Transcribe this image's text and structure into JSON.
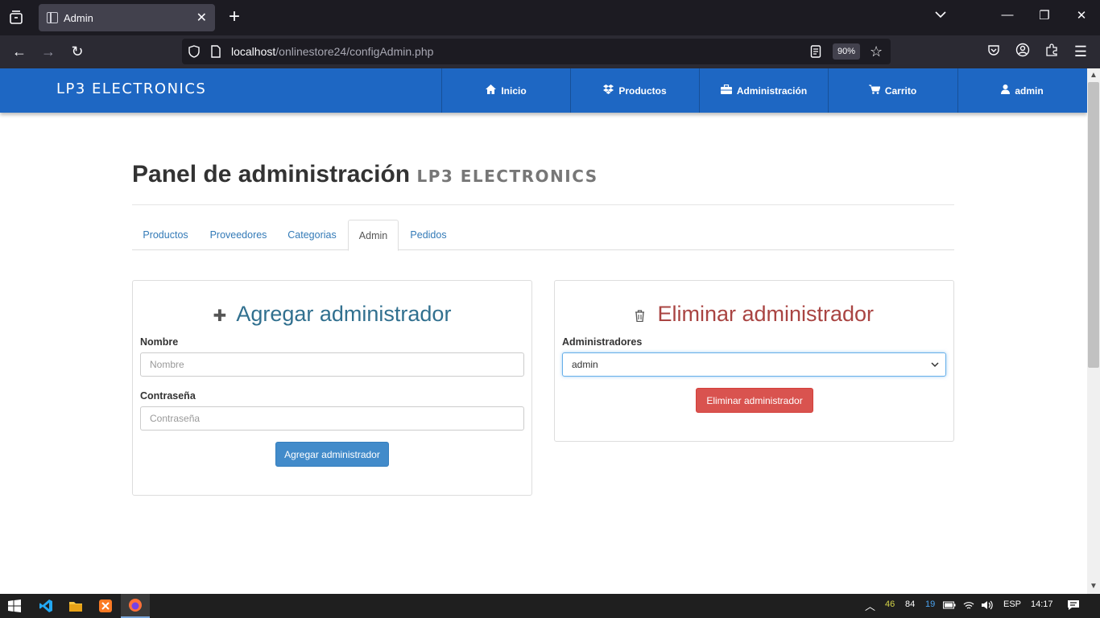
{
  "browser": {
    "tab_title": "Admin",
    "url_host": "localhost",
    "url_path": "/onlinestore24/configAdmin.php",
    "zoom": "90%"
  },
  "header": {
    "brand": "LP3 ELECTRONICS",
    "nav": [
      {
        "label": "Inicio",
        "icon": "home-icon"
      },
      {
        "label": "Productos",
        "icon": "dropbox-icon"
      },
      {
        "label": "Administración",
        "icon": "briefcase-icon"
      },
      {
        "label": "Carrito",
        "icon": "cart-icon"
      },
      {
        "label": "admin",
        "icon": "user-icon"
      }
    ]
  },
  "page": {
    "title": "Panel de administración",
    "title_sub": "LP3 ELECTRONICS",
    "tabs": [
      "Productos",
      "Proveedores",
      "Categorias",
      "Admin",
      "Pedidos"
    ],
    "active_tab": "Admin"
  },
  "add_panel": {
    "heading": "Agregar administrador",
    "name_label": "Nombre",
    "name_placeholder": "Nombre",
    "password_label": "Contraseña",
    "password_placeholder": "Contraseña",
    "button": "Agregar administrador",
    "heading_color": "#31708f"
  },
  "delete_panel": {
    "heading": "Eliminar administrador",
    "select_label": "Administradores",
    "selected": "admin",
    "button": "Eliminar administrador",
    "heading_color": "#a94442"
  },
  "taskbar": {
    "tray": {
      "temp1": "46",
      "temp2": "84",
      "temp3": "19",
      "lang": "ESP",
      "time": "14:17"
    }
  },
  "colors": {
    "brand": "#1e67c3",
    "primary": "#428bca",
    "danger": "#d9534f"
  }
}
